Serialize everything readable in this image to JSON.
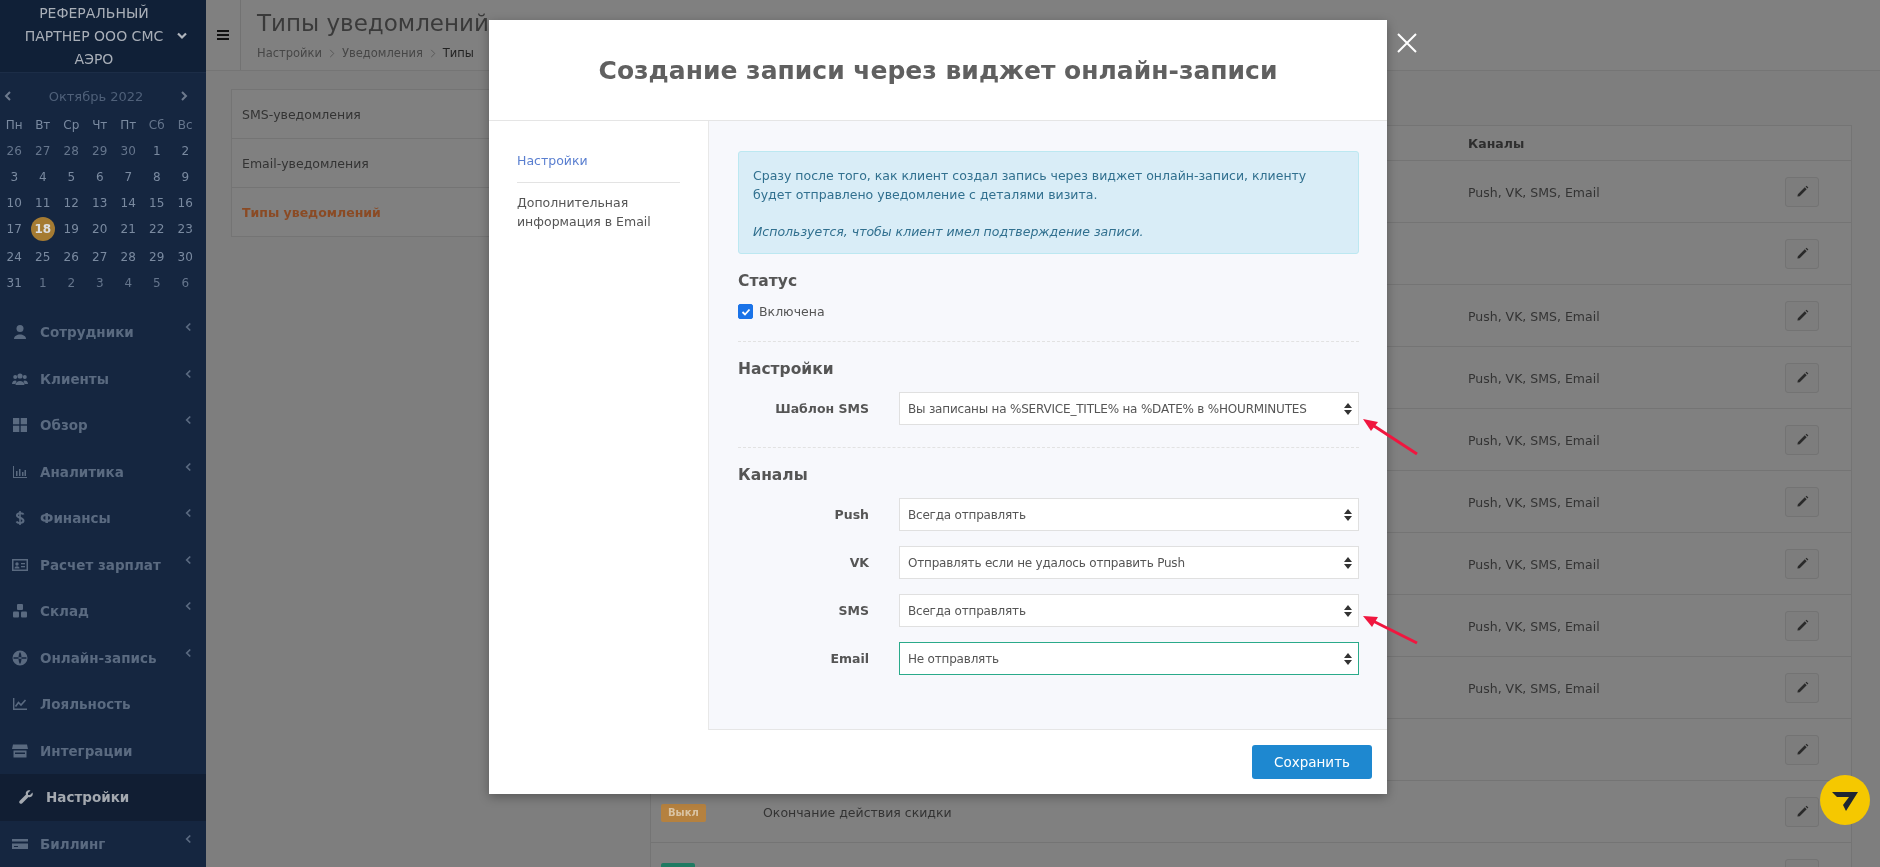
{
  "sidebar": {
    "brand": "РЕФЕРАЛЬНЫЙ ПАРТНЕР ООО СМС АЭРО",
    "calendar": {
      "month": "Октябрь 2022",
      "weekdays": [
        {
          "label": "Пн",
          "weekend": false
        },
        {
          "label": "Вт",
          "weekend": false
        },
        {
          "label": "Ср",
          "weekend": false
        },
        {
          "label": "Чт",
          "weekend": false
        },
        {
          "label": "Пт",
          "weekend": false
        },
        {
          "label": "Сб",
          "weekend": true
        },
        {
          "label": "Вс",
          "weekend": true
        }
      ],
      "weeks": [
        [
          {
            "label": "26",
            "outside": true,
            "selected": false
          },
          {
            "label": "27",
            "outside": true,
            "selected": false
          },
          {
            "label": "28",
            "outside": true,
            "selected": false
          },
          {
            "label": "29",
            "outside": true,
            "selected": false
          },
          {
            "label": "30",
            "outside": true,
            "selected": false
          },
          {
            "label": "1",
            "outside": false,
            "selected": false
          },
          {
            "label": "2",
            "outside": false,
            "selected": false
          }
        ],
        [
          {
            "label": "3",
            "outside": false,
            "selected": false
          },
          {
            "label": "4",
            "outside": false,
            "selected": false
          },
          {
            "label": "5",
            "outside": false,
            "selected": false
          },
          {
            "label": "6",
            "outside": false,
            "selected": false
          },
          {
            "label": "7",
            "outside": false,
            "selected": false
          },
          {
            "label": "8",
            "outside": false,
            "selected": false
          },
          {
            "label": "9",
            "outside": false,
            "selected": false
          }
        ],
        [
          {
            "label": "10",
            "outside": false,
            "selected": false
          },
          {
            "label": "11",
            "outside": false,
            "selected": false
          },
          {
            "label": "12",
            "outside": false,
            "selected": false
          },
          {
            "label": "13",
            "outside": false,
            "selected": false
          },
          {
            "label": "14",
            "outside": false,
            "selected": false
          },
          {
            "label": "15",
            "outside": false,
            "selected": false
          },
          {
            "label": "16",
            "outside": false,
            "selected": false
          }
        ],
        [
          {
            "label": "17",
            "outside": false,
            "selected": false
          },
          {
            "label": "18",
            "outside": false,
            "selected": true
          },
          {
            "label": "19",
            "outside": false,
            "selected": false
          },
          {
            "label": "20",
            "outside": false,
            "selected": false
          },
          {
            "label": "21",
            "outside": false,
            "selected": false
          },
          {
            "label": "22",
            "outside": false,
            "selected": false
          },
          {
            "label": "23",
            "outside": false,
            "selected": false
          }
        ],
        [
          {
            "label": "24",
            "outside": false,
            "selected": false
          },
          {
            "label": "25",
            "outside": false,
            "selected": false
          },
          {
            "label": "26",
            "outside": false,
            "selected": false
          },
          {
            "label": "27",
            "outside": false,
            "selected": false
          },
          {
            "label": "28",
            "outside": false,
            "selected": false
          },
          {
            "label": "29",
            "outside": false,
            "selected": false
          },
          {
            "label": "30",
            "outside": false,
            "selected": false
          }
        ],
        [
          {
            "label": "31",
            "outside": false,
            "selected": false
          },
          {
            "label": "1",
            "outside": true,
            "selected": false
          },
          {
            "label": "2",
            "outside": true,
            "selected": false
          },
          {
            "label": "3",
            "outside": true,
            "selected": false
          },
          {
            "label": "4",
            "outside": true,
            "selected": false
          },
          {
            "label": "5",
            "outside": true,
            "selected": false
          },
          {
            "label": "6",
            "outside": true,
            "selected": false
          }
        ]
      ]
    },
    "menu": [
      {
        "label": "Сотрудники",
        "selected": false,
        "submenu": true
      },
      {
        "label": "Клиенты",
        "selected": false,
        "submenu": true
      },
      {
        "label": "Обзор",
        "selected": false,
        "submenu": true
      },
      {
        "label": "Аналитика",
        "selected": false,
        "submenu": true
      },
      {
        "label": "Финансы",
        "selected": false,
        "submenu": true
      },
      {
        "label": "Расчет зарплат",
        "selected": false,
        "submenu": true
      },
      {
        "label": "Склад",
        "selected": false,
        "submenu": true
      },
      {
        "label": "Онлайн-запись",
        "selected": false,
        "submenu": true
      },
      {
        "label": "Лояльность",
        "selected": false,
        "submenu": false
      },
      {
        "label": "Интеграции",
        "selected": false,
        "submenu": false
      },
      {
        "label": "Настройки",
        "selected": true,
        "submenu": false
      },
      {
        "label": "Биллинг",
        "selected": false,
        "submenu": true
      }
    ]
  },
  "header": {
    "title": "Типы уведомлений",
    "breadcrumb": [
      "Настройки",
      "Уведомления",
      "Типы"
    ]
  },
  "side_nav": [
    {
      "label": "SMS-уведомления",
      "selected": false
    },
    {
      "label": "Email-уведомления",
      "selected": false
    },
    {
      "label": "Типы уведомлений",
      "selected": true
    }
  ],
  "table": {
    "column_header": "Каналы",
    "rows": [
      {
        "channels": "Push, VK, SMS, Email"
      },
      {},
      {
        "channels": "Push, VK, SMS, Email"
      },
      {
        "channels": "Push, VK, SMS, Email"
      },
      {
        "channels": "Push, VK, SMS, Email"
      },
      {
        "channels": "Push, VK, SMS, Email"
      },
      {
        "channels": "Push, VK, SMS, Email"
      },
      {
        "channels": "Push, VK, SMS, Email"
      },
      {
        "channels": "Push, VK, SMS, Email"
      },
      {},
      {
        "status": {
          "label": "Выкл",
          "color": "#b5813f"
        },
        "name": "Окончание действия скидки"
      },
      {
        "status": {
          "color": "#1f7a62"
        }
      }
    ]
  },
  "modal": {
    "title": "Создание записи через виджет онлайн-записи",
    "nav": [
      {
        "label": "Настройки",
        "selected": true
      },
      {
        "label": "Дополнительная информация в Email",
        "selected": false
      }
    ],
    "alert": {
      "text": "Сразу после того, как клиент создал запись через виджет онлайн-записи, клиенту будет отправлено уведомление с деталями визита.",
      "note": "Используется, чтобы клиент имел подтверждение записи."
    },
    "status": {
      "heading": "Статус",
      "checkbox": {
        "label": "Включена",
        "checked": true
      }
    },
    "settings": {
      "heading": "Настройки",
      "fields": [
        {
          "label": "Шаблон SMS",
          "value": "Вы записаны на %SERVICE_TITLE% на %DATE% в %HOURMINUTES"
        }
      ]
    },
    "channels": {
      "heading": "Каналы",
      "rows": [
        {
          "label": "Push",
          "value": "Всегда отправлять",
          "focused": false
        },
        {
          "label": "VK",
          "value": "Отправлять если не удалось отправить Push",
          "focused": false
        },
        {
          "label": "SMS",
          "value": "Всегда отправлять",
          "focused": false
        },
        {
          "label": "Email",
          "value": "Не отправлять",
          "focused": true
        }
      ]
    },
    "save_button": "Сохранить"
  }
}
